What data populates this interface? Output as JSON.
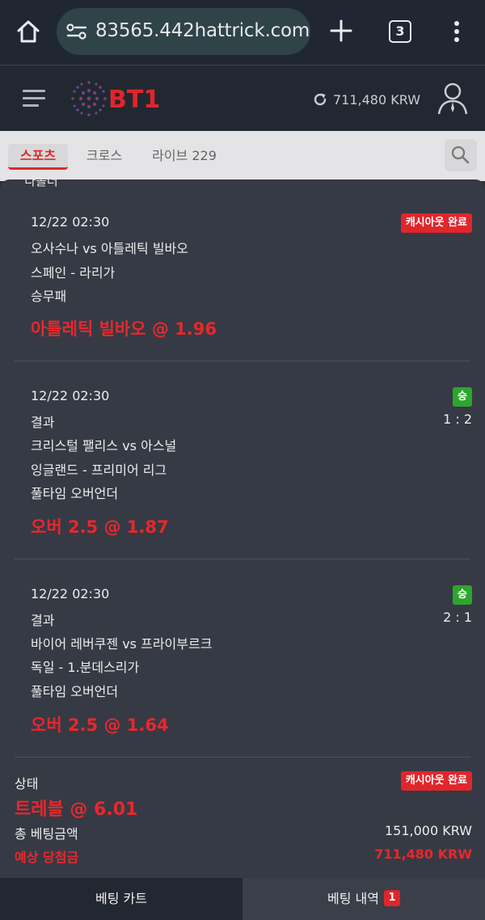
{
  "browser": {
    "url": "83565.442hattrick.com",
    "tab_count": "3"
  },
  "header": {
    "logo_text": "BT1",
    "balance": "711,480 KRW"
  },
  "subnav": {
    "tabs": [
      {
        "label": "스포츠",
        "active": true
      },
      {
        "label": "크로스",
        "active": false
      },
      {
        "label": "라이브 229",
        "active": false
      }
    ]
  },
  "panel": {
    "collapse_label": "˅  다폴더"
  },
  "bets": [
    {
      "datetime": "12/22 02:30",
      "status": "캐시아웃 완료",
      "match": "오사수나 vs 아틀레틱 빌바오",
      "league": "스페인 - 라리가",
      "market": "승무패",
      "pick": "아틀레틱 빌바오 @ 1.96"
    },
    {
      "datetime": "12/22 02:30",
      "status": "승",
      "result_label": "결과",
      "score": "1 : 2",
      "match": "크리스털 팰리스 vs 아스널",
      "league": "잉글랜드 - 프리미어 리그",
      "market": "풀타임 오버언더",
      "pick": "오버 2.5 @ 1.87"
    },
    {
      "datetime": "12/22 02:30",
      "status": "승",
      "result_label": "결과",
      "score": "2 : 1",
      "match": "바이어 레버쿠젠 vs 프라이부르크",
      "league": "독일 - 1.분데스리가",
      "market": "풀타임 오버언더",
      "pick": "오버 2.5 @ 1.64"
    }
  ],
  "summary": {
    "status_label": "상태",
    "status": "캐시아웃 완료",
    "combo": "트레블 @ 6.01",
    "total_stake_label": "총 베팅금액",
    "total_stake": "151,000 KRW",
    "expected_win_label": "예상 당첨금",
    "expected_win": "711,480 KRW"
  },
  "bottom": {
    "cart_label": "베팅 카트",
    "history_label": "베팅 내역",
    "history_count": "1"
  },
  "colors": {
    "accent_red": "#e0262b",
    "win_green": "#2ea52e",
    "panel_bg": "#363a44",
    "browser_bg": "#202632"
  }
}
